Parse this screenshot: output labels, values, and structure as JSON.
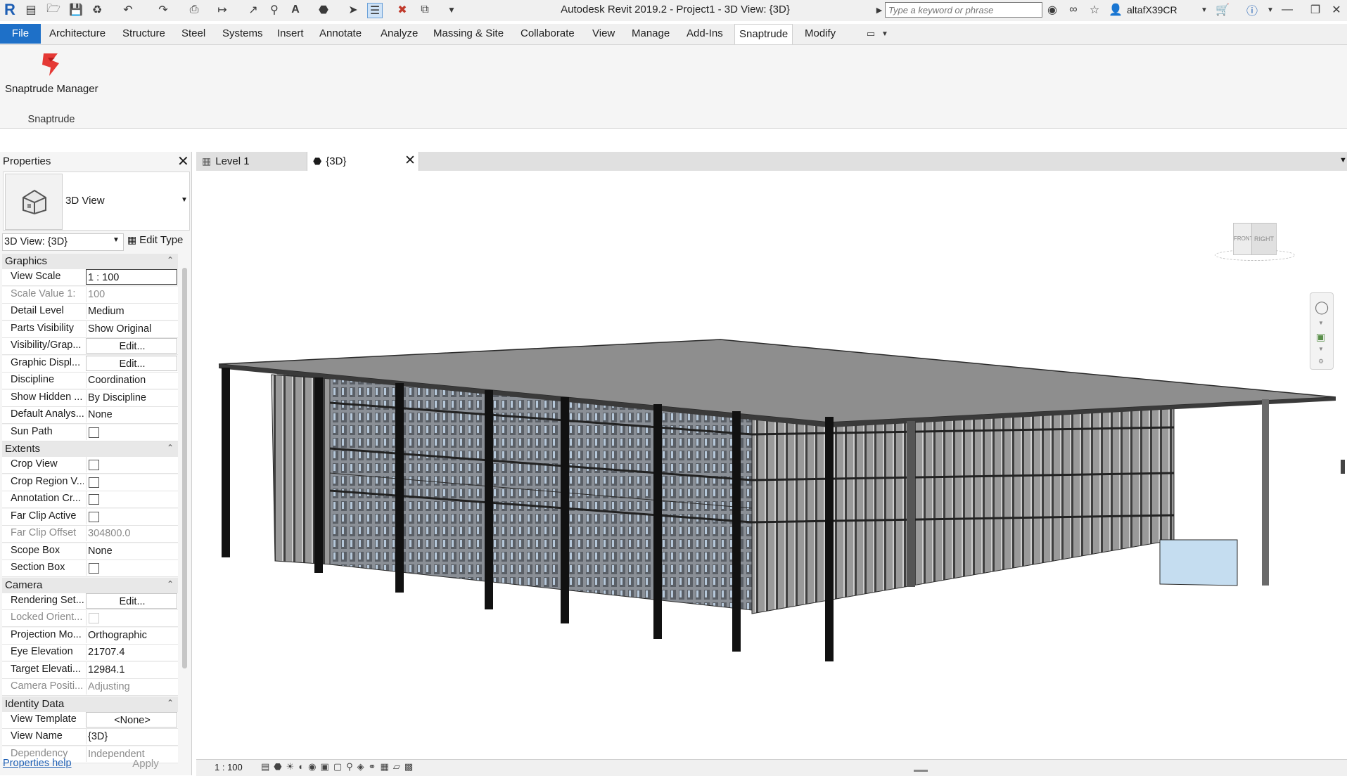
{
  "app_title": "Autodesk Revit 2019.2 - Project1 - 3D View: {3D}",
  "search": {
    "placeholder": "Type a keyword or phrase"
  },
  "user": {
    "name": "altafX39CR"
  },
  "ribbon": {
    "tabs": [
      "File",
      "Architecture",
      "Structure",
      "Steel",
      "Systems",
      "Insert",
      "Annotate",
      "Analyze",
      "Massing & Site",
      "Collaborate",
      "View",
      "Manage",
      "Add-Ins",
      "Snaptrude",
      "Modify"
    ],
    "active_tab": "Snaptrude",
    "button_label": "Snaptrude Manager",
    "panel_label": "Snaptrude"
  },
  "properties": {
    "title": "Properties",
    "type_name": "3D View",
    "instance_selector": "3D View: {3D}",
    "edit_type_label": "Edit Type",
    "sections": [
      {
        "name": "Graphics",
        "rows": [
          {
            "label": "View Scale",
            "value": "1 : 100",
            "kind": "box"
          },
          {
            "label": "Scale Value    1:",
            "value": "100",
            "kind": "dim"
          },
          {
            "label": "Detail Level",
            "value": "Medium"
          },
          {
            "label": "Parts Visibility",
            "value": "Show Original"
          },
          {
            "label": "Visibility/Grap...",
            "value": "Edit...",
            "kind": "btn"
          },
          {
            "label": "Graphic Displ...",
            "value": "Edit...",
            "kind": "btn"
          },
          {
            "label": "Discipline",
            "value": "Coordination"
          },
          {
            "label": "Show Hidden ...",
            "value": "By Discipline"
          },
          {
            "label": "Default Analys...",
            "value": "None"
          },
          {
            "label": "Sun Path",
            "value": "",
            "kind": "chk"
          }
        ]
      },
      {
        "name": "Extents",
        "rows": [
          {
            "label": "Crop View",
            "value": "",
            "kind": "chk"
          },
          {
            "label": "Crop Region V...",
            "value": "",
            "kind": "chk"
          },
          {
            "label": "Annotation Cr...",
            "value": "",
            "kind": "chk"
          },
          {
            "label": "Far Clip Active",
            "value": "",
            "kind": "chk"
          },
          {
            "label": "Far Clip Offset",
            "value": "304800.0",
            "kind": "dim"
          },
          {
            "label": "Scope Box",
            "value": "None"
          },
          {
            "label": "Section Box",
            "value": "",
            "kind": "chk"
          }
        ]
      },
      {
        "name": "Camera",
        "rows": [
          {
            "label": "Rendering Set...",
            "value": "Edit...",
            "kind": "btn"
          },
          {
            "label": "Locked Orient...",
            "value": "",
            "kind": "chkdim"
          },
          {
            "label": "Projection Mo...",
            "value": "Orthographic"
          },
          {
            "label": "Eye Elevation",
            "value": "21707.4"
          },
          {
            "label": "Target Elevati...",
            "value": "12984.1"
          },
          {
            "label": "Camera Positi...",
            "value": "Adjusting",
            "kind": "dim"
          }
        ]
      },
      {
        "name": "Identity Data",
        "rows": [
          {
            "label": "View Template",
            "value": "<None>",
            "kind": "btn"
          },
          {
            "label": "View Name",
            "value": "{3D}"
          },
          {
            "label": "Dependency",
            "value": "Independent",
            "kind": "dim"
          }
        ]
      }
    ],
    "help_link": "Properties help",
    "apply_label": "Apply"
  },
  "view_tabs": [
    {
      "label": "Level 1",
      "active": false
    },
    {
      "label": "{3D}",
      "active": true
    }
  ],
  "viewcube": {
    "front": "FRONT",
    "right": "RIGHT"
  },
  "status": {
    "scale": "1 : 100"
  }
}
